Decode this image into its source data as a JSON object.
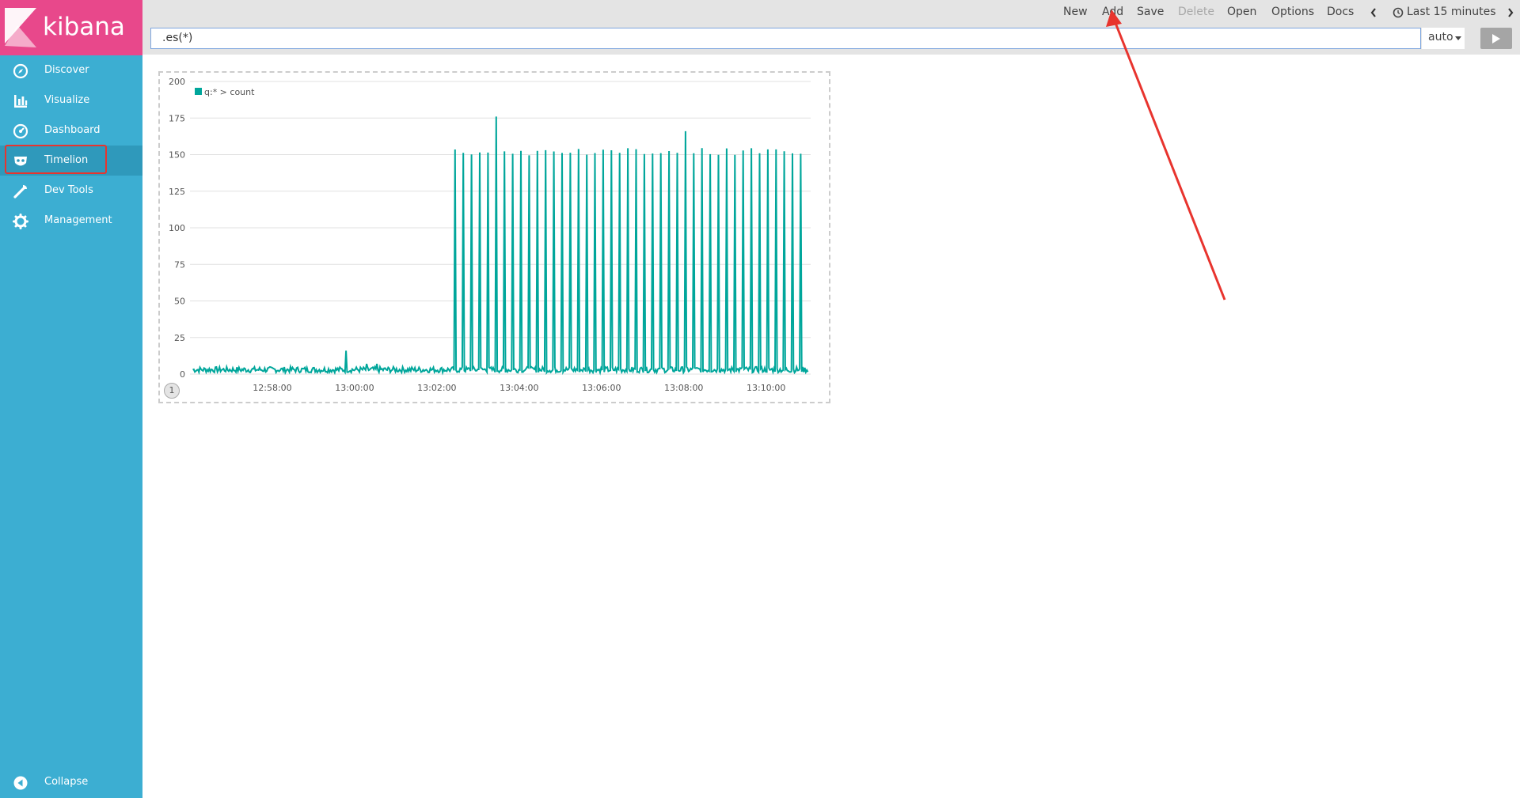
{
  "app": {
    "name": "kibana"
  },
  "sidebar": {
    "items": [
      {
        "label": "Discover",
        "icon": "compass-icon"
      },
      {
        "label": "Visualize",
        "icon": "bar-chart-icon"
      },
      {
        "label": "Dashboard",
        "icon": "dashboard-gauge-icon"
      },
      {
        "label": "Timelion",
        "icon": "timelion-mask-icon",
        "active": true
      },
      {
        "label": "Dev Tools",
        "icon": "wrench-icon"
      },
      {
        "label": "Management",
        "icon": "gear-icon"
      }
    ],
    "collapse_label": "Collapse"
  },
  "toolbar": {
    "new_label": "New",
    "add_label": "Add",
    "save_label": "Save",
    "delete_label": "Delete",
    "open_label": "Open",
    "options_label": "Options",
    "docs_label": "Docs",
    "time_range_label": "Last 15 minutes"
  },
  "expression": {
    "value": ".es(*)"
  },
  "interval": {
    "selected": "auto"
  },
  "sheet": {
    "number": "1"
  },
  "colors": {
    "sidebar": "#3caed2",
    "logo_bg": "#e8488b",
    "series": "#00a69b",
    "annotation": "#e8342e"
  },
  "chart_data": {
    "type": "line",
    "legend": [
      "q:* > count"
    ],
    "legend_position": "top-left",
    "grid": true,
    "y_ticks": [
      0,
      25,
      50,
      75,
      100,
      125,
      150,
      175,
      200
    ],
    "ylim": [
      0,
      200
    ],
    "x_ticks": [
      "12:58:00",
      "13:00:00",
      "13:02:00",
      "13:04:00",
      "13:06:00",
      "13:08:00",
      "13:10:00"
    ],
    "x_range": [
      "12:56:00",
      "13:11:05"
    ],
    "series": [
      {
        "name": "q:* > count",
        "baseline": 3,
        "early_spikes": [
          {
            "time": "12:59:48",
            "value": 16
          },
          {
            "time": "13:00:18",
            "value": 7
          },
          {
            "time": "13:00:33",
            "value": 7
          }
        ],
        "burst_start": "13:02:15",
        "burst_period_seconds": 12,
        "burst_peak": 152,
        "burst_high_peaks": [
          {
            "time": "13:03:27",
            "value": 176
          },
          {
            "time": "13:08:03",
            "value": 166
          }
        ],
        "burst_end": "13:11:00"
      }
    ]
  }
}
